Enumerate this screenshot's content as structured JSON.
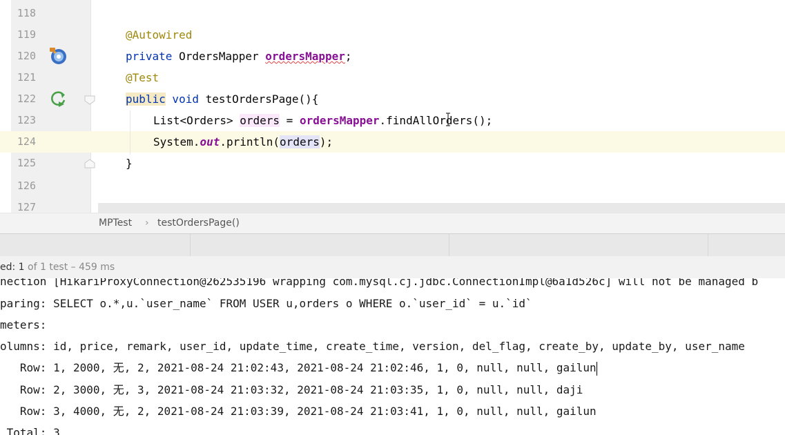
{
  "editor": {
    "lines": [
      {
        "num": "118"
      },
      {
        "num": "119",
        "annotation": "@Autowired"
      },
      {
        "num": "120",
        "kw": "private",
        "type": " OrdersMapper ",
        "field": "ordersMapper",
        "end": ";"
      },
      {
        "num": "121",
        "annotation": "@Test"
      },
      {
        "num": "122",
        "kw1": "public",
        "kw2": " void",
        "rest": " testOrdersPage(){"
      },
      {
        "num": "123",
        "t1": "List<Orders> ",
        "var": "orders",
        "t2": " = ",
        "field": "ordersMapper",
        "t3": ".findAllOrders();"
      },
      {
        "num": "124",
        "t1": "System.",
        "static": "out",
        "t2": ".println(",
        "var": "orders",
        "t3": ");"
      },
      {
        "num": "125",
        "brace": "}"
      },
      {
        "num": "126"
      },
      {
        "num": "127"
      }
    ],
    "current_line": "124"
  },
  "breadcrumb": {
    "class_name": "MPTest",
    "separator": "›",
    "method_name": "testOrdersPage()"
  },
  "status": {
    "passed_prefix": "ed: 1",
    "detail": " of 1 test – 459 ms"
  },
  "console": {
    "lines": [
      "nection [HikariProxyConnection@262535196 wrapping com.mysql.cj.jdbc.ConnectionImpl@6a1d526c] will not be managed b",
      "paring: SELECT o.*,u.`user_name` FROM USER u,orders o WHERE o.`user_id` = u.`id`",
      "meters: ",
      "olumns: id, price, remark, user_id, update_time, create_time, version, del_flag, create_by, update_by, user_name",
      "   Row: 1, 2000, 无, 2, 2021-08-24 21:02:43, 2021-08-24 21:02:46, 1, 0, null, null, gailun",
      "   Row: 2, 3000, 无, 3, 2021-08-24 21:03:32, 2021-08-24 21:03:35, 1, 0, null, null, daji",
      "   Row: 3, 4000, 无, 2, 2021-08-24 21:03:39, 2021-08-24 21:03:41, 1, 0, null, null, gailun",
      " Total: 3"
    ]
  },
  "colors": {
    "keyword": "#0033b3",
    "annotation": "#9e880d",
    "field": "#871094",
    "current_line": "#fcfae4"
  }
}
